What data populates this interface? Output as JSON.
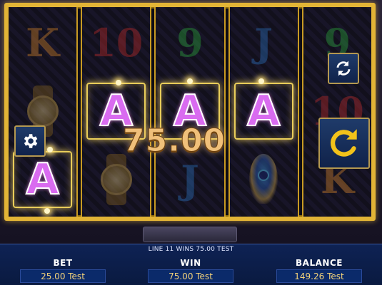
{
  "reels": [
    {
      "symbols": [
        "K",
        "watch",
        "A"
      ],
      "win_rows": [
        2
      ]
    },
    {
      "symbols": [
        "10",
        "A",
        "watch"
      ],
      "win_rows": [
        1
      ]
    },
    {
      "symbols": [
        "9",
        "A",
        "J"
      ],
      "win_rows": [
        1
      ]
    },
    {
      "symbols": [
        "J",
        "A",
        "feather"
      ],
      "win_rows": [
        1
      ]
    },
    {
      "symbols": [
        "9",
        "10",
        "K"
      ],
      "win_rows": []
    }
  ],
  "win_amount": "75.00",
  "message": "LINE 11 WINS 75.00 TEST",
  "stats": {
    "bet": {
      "label": "BET",
      "value": "25.00 Test"
    },
    "win": {
      "label": "WIN",
      "value": "75.00 Test"
    },
    "balance": {
      "label": "BALANCE",
      "value": "149.26 Test"
    }
  },
  "colors": {
    "frame_gold": "#e2b436",
    "ace_purple": "#d96bf0",
    "panel_blue": "#0e2254",
    "value_gold": "#f2d27a"
  },
  "icons": {
    "settings": "gear-icon",
    "autoplay": "autoplay-loop-icon",
    "spin": "spin-arrow-icon"
  }
}
